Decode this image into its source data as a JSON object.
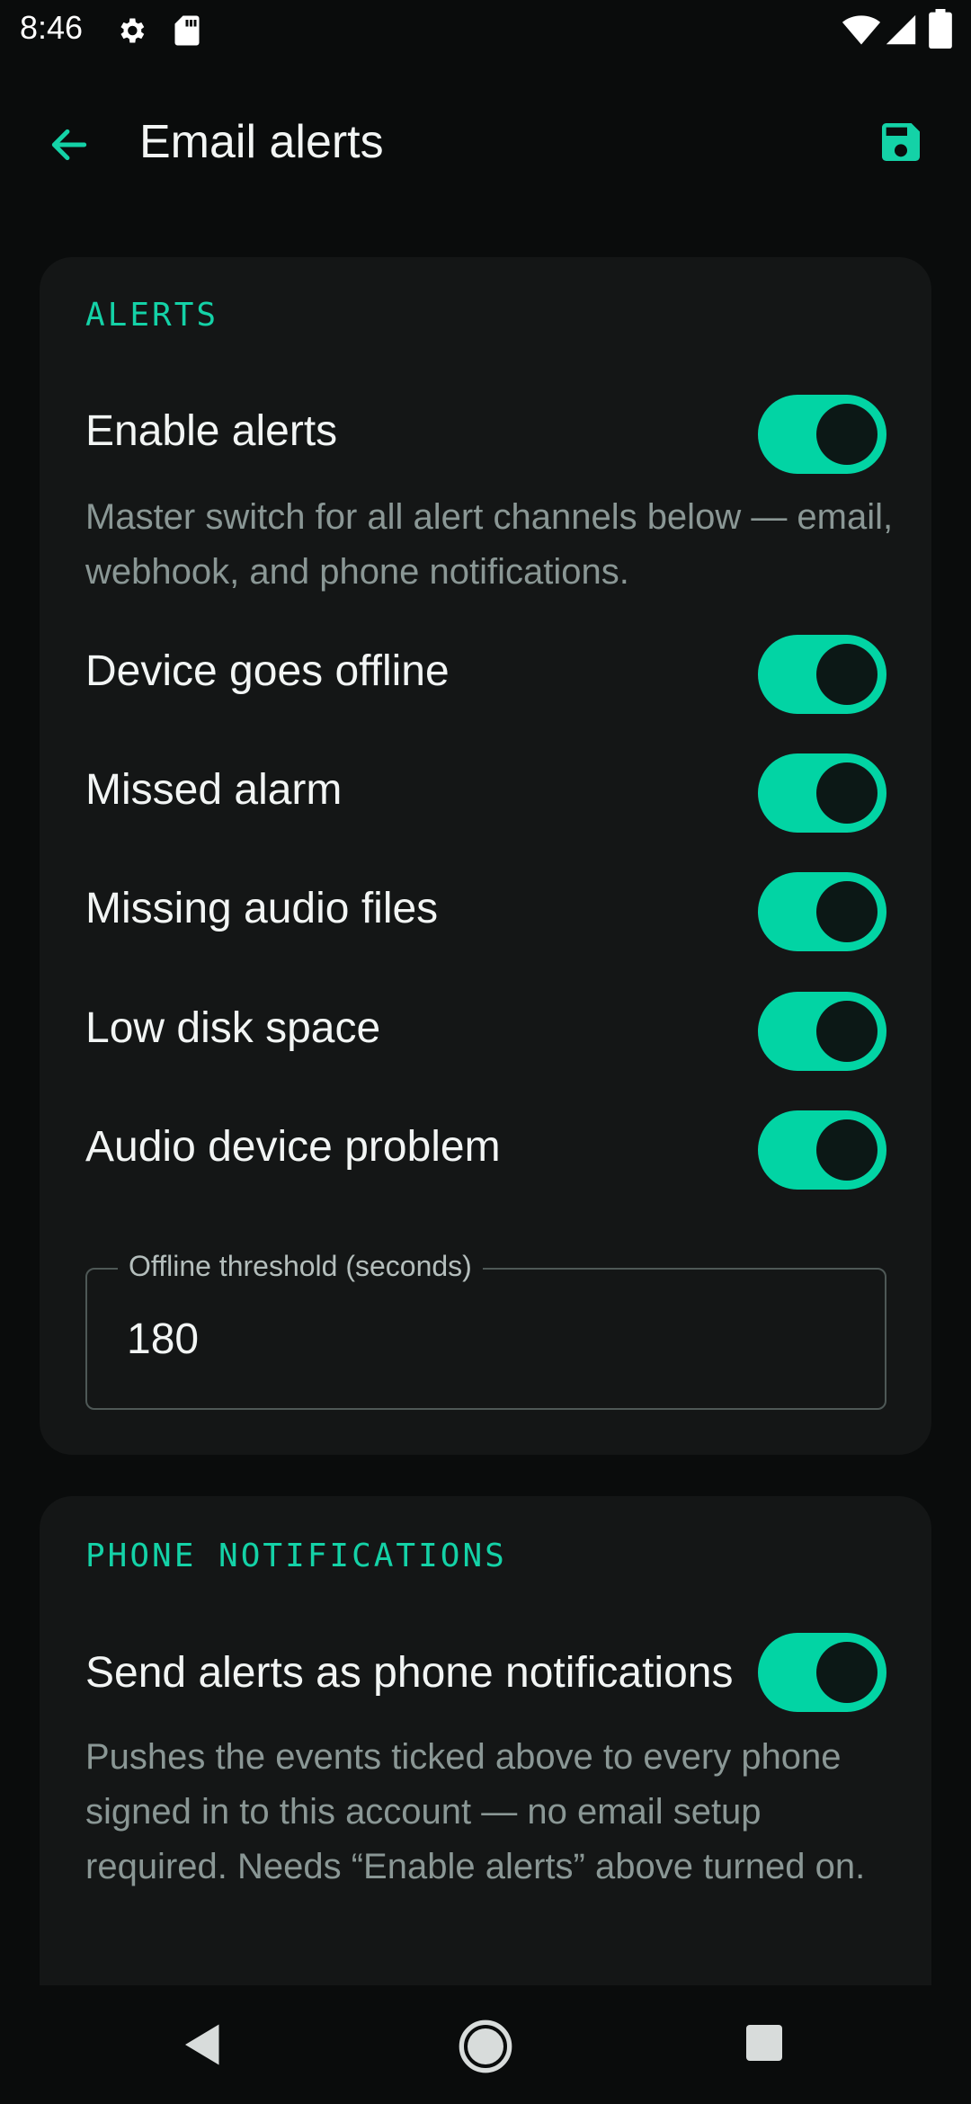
{
  "status_bar": {
    "time": "8:46",
    "icons": [
      "gear-icon",
      "sd-card-icon",
      "wifi-icon",
      "cell-signal-icon",
      "battery-icon"
    ]
  },
  "app_bar": {
    "title": "Email alerts",
    "back_icon": "arrow-back-icon",
    "save_icon": "save-icon"
  },
  "colors": {
    "accent": "#02d4a4",
    "background": "#0a0c0c",
    "card": "#141616",
    "muted_text": "#8a9795"
  },
  "alerts": {
    "section_title": "ALERTS",
    "enable": {
      "label": "Enable alerts",
      "description": "Master switch for all alert channels below — email, webhook, and phone notifications.",
      "on": true
    },
    "items": [
      {
        "label": "Device goes offline",
        "on": true
      },
      {
        "label": "Missed alarm",
        "on": true
      },
      {
        "label": "Missing audio files",
        "on": true
      },
      {
        "label": "Low disk space",
        "on": true
      },
      {
        "label": "Audio device problem",
        "on": true
      }
    ],
    "threshold": {
      "label": "Offline threshold (seconds)",
      "value": "180"
    }
  },
  "phone": {
    "section_title": "PHONE NOTIFICATIONS",
    "send": {
      "label": "Send alerts as phone notifications",
      "description": "Pushes the events ticked above to every phone signed in to this account — no email setup required. Needs “Enable alerts” above turned on.",
      "on": true
    }
  },
  "nav_bar": {
    "icons": [
      "nav-back-icon",
      "nav-home-icon",
      "nav-recents-icon"
    ]
  }
}
